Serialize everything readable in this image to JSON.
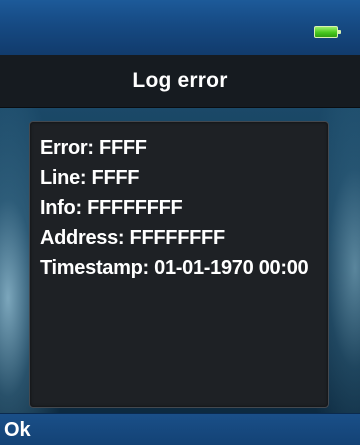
{
  "status_bar": {
    "battery_icon": "battery-full-icon",
    "battery_color": "#48c81f"
  },
  "title_bar": {
    "title": "Log error"
  },
  "dialog": {
    "error": "Error: FFFF",
    "line": "Line: FFFF",
    "info": "Info: FFFFFFFF",
    "address": "Address: FFFFFFFF",
    "timestamp": "Timestamp: 01-01-1970 00:00"
  },
  "softkeys": {
    "left_label": "Ok"
  },
  "colors": {
    "bar_blue": "#164a83",
    "title_bg": "#161b20",
    "dialog_bg": "#1e2125",
    "text": "#ffffff"
  }
}
